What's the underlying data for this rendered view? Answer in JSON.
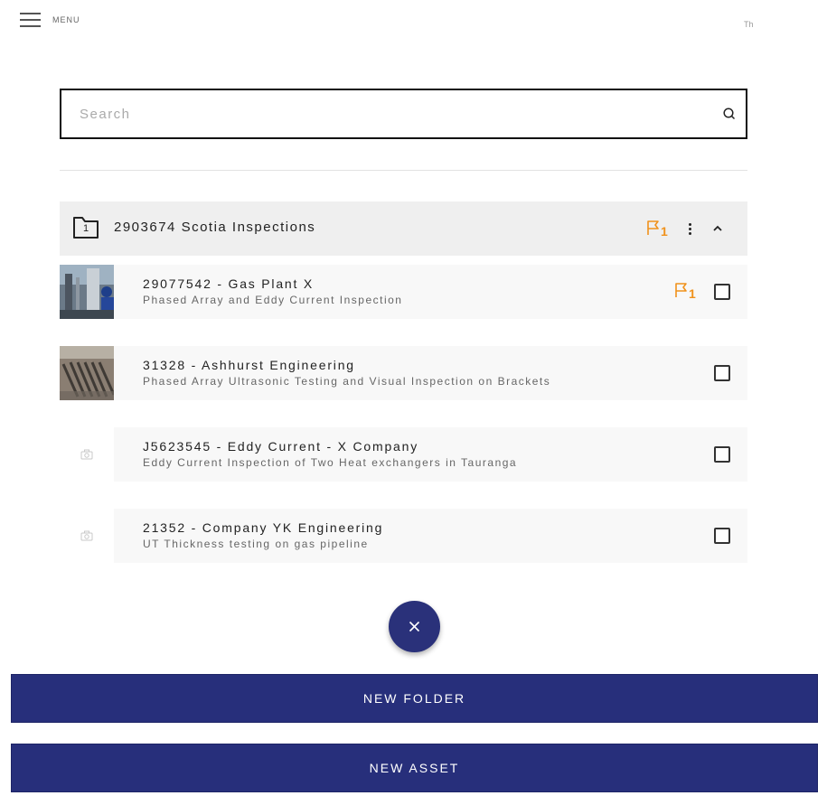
{
  "header": {
    "menu_label": "MENU",
    "user_initial": "Th"
  },
  "search": {
    "placeholder": "Search",
    "value": ""
  },
  "folder": {
    "title": "2903674 Scotia Inspections",
    "count": "1",
    "flag_count": "1"
  },
  "assets": [
    {
      "title": "29077542 - Gas Plant X",
      "subtitle": "Phased Array and Eddy Current Inspection",
      "flag_count": "1",
      "has_photo": true
    },
    {
      "title": "31328 - Ashhurst Engineering",
      "subtitle": "Phased Array Ultrasonic Testing and Visual Inspection on Brackets",
      "has_photo": true
    },
    {
      "title": "J5623545 - Eddy Current - X Company",
      "subtitle": "Eddy Current Inspection of Two Heat exchangers in Tauranga",
      "has_photo": false
    },
    {
      "title": "21352 - Company YK Engineering",
      "subtitle": "UT Thickness testing on gas pipeline",
      "has_photo": false
    }
  ],
  "actions": {
    "new_folder": "NEW FOLDER",
    "new_asset": "NEW ASSET"
  },
  "colors": {
    "accent": "#272f7b",
    "flag": "#f0921c",
    "folder_bg": "#efefef",
    "card_bg": "#f8f8f8"
  },
  "icons": {
    "menu": "hamburger-icon",
    "search": "search-icon",
    "folder": "folder-icon",
    "flag": "flag-icon",
    "more": "kebab-icon",
    "collapse": "chevron-up-icon",
    "camera": "camera-icon",
    "close": "close-icon"
  }
}
